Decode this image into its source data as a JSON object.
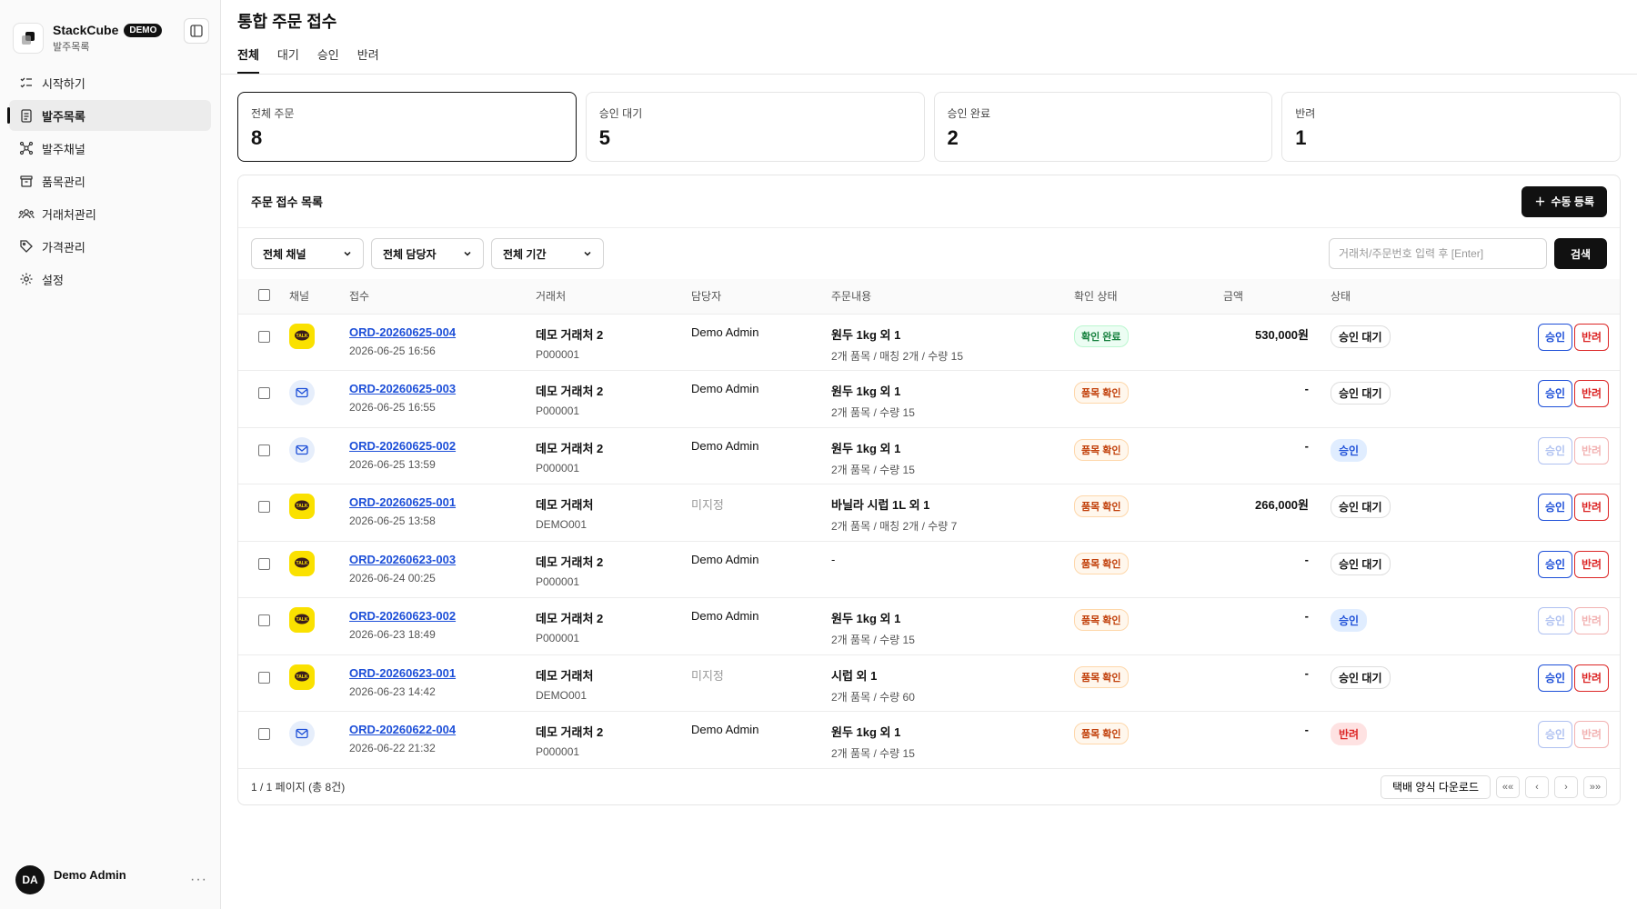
{
  "brand": {
    "name": "StackCube",
    "badge": "DEMO",
    "subtitle": "발주목록"
  },
  "sidebar": {
    "items": [
      {
        "label": "시작하기",
        "icon": "checklist-icon"
      },
      {
        "label": "발주목록",
        "icon": "clipboard-list-icon",
        "active": true
      },
      {
        "label": "발주채널",
        "icon": "network-icon"
      },
      {
        "label": "품목관리",
        "icon": "archive-box-icon"
      },
      {
        "label": "거래처관리",
        "icon": "users-icon"
      },
      {
        "label": "가격관리",
        "icon": "tag-icon"
      },
      {
        "label": "설정",
        "icon": "gear-icon"
      }
    ]
  },
  "user": {
    "initials": "DA",
    "name": "Demo Admin"
  },
  "page": {
    "title": "통합 주문 접수"
  },
  "tabs": [
    {
      "label": "전체"
    },
    {
      "label": "대기"
    },
    {
      "label": "승인"
    },
    {
      "label": "반려"
    }
  ],
  "stats": [
    {
      "label": "전체 주문",
      "value": "8"
    },
    {
      "label": "승인 대기",
      "value": "5"
    },
    {
      "label": "승인 완료",
      "value": "2"
    },
    {
      "label": "반려",
      "value": "1"
    }
  ],
  "panel": {
    "title": "주문 접수 목록",
    "add_label": "수동 등록"
  },
  "filters": {
    "channel": "전체 채널",
    "manager": "전체 담당자",
    "period": "전체 기간",
    "search_placeholder": "거래처/주문번호 입력 후 [Enter]",
    "search_label": "검색"
  },
  "table": {
    "headers": {
      "channel": "채널",
      "received": "접수",
      "client": "거래처",
      "manager": "담당자",
      "content": "주문내용",
      "check": "확인 상태",
      "amount": "금액",
      "status": "상태"
    },
    "rows": [
      {
        "channel": "kakao",
        "order_no": "ORD-20260625-004",
        "date": "2026-06-25 16:56",
        "client": "데모 거래처 2",
        "client_code": "P000001",
        "manager": "Demo Admin",
        "item": "원두 1kg 외 1",
        "detail": "2개 품목 / 매칭 2개 / 수량 15",
        "check": "확인 완료",
        "amount": "530,000원",
        "status": "승인 대기"
      },
      {
        "channel": "mail",
        "order_no": "ORD-20260625-003",
        "date": "2026-06-25 16:55",
        "client": "데모 거래처 2",
        "client_code": "P000001",
        "manager": "Demo Admin",
        "item": "원두 1kg 외 1",
        "detail": "2개 품목 / 수량 15",
        "check": "품목 확인",
        "amount": "-",
        "status": "승인 대기"
      },
      {
        "channel": "mail",
        "order_no": "ORD-20260625-002",
        "date": "2026-06-25 13:59",
        "client": "데모 거래처 2",
        "client_code": "P000001",
        "manager": "Demo Admin",
        "item": "원두 1kg 외 1",
        "detail": "2개 품목 / 수량 15",
        "check": "품목 확인",
        "amount": "-",
        "status": "승인"
      },
      {
        "channel": "kakao",
        "order_no": "ORD-20260625-001",
        "date": "2026-06-25 13:58",
        "client": "데모 거래처",
        "client_code": "DEMO001",
        "manager": "미지정",
        "item": "바닐라 시럽 1L 외 1",
        "detail": "2개 품목 / 매칭 2개 / 수량 7",
        "check": "품목 확인",
        "amount": "266,000원",
        "status": "승인 대기"
      },
      {
        "channel": "kakao",
        "order_no": "ORD-20260623-003",
        "date": "2026-06-24 00:25",
        "client": "데모 거래처 2",
        "client_code": "P000001",
        "manager": "Demo Admin",
        "item": "-",
        "detail": "",
        "check": "품목 확인",
        "amount": "-",
        "status": "승인 대기"
      },
      {
        "channel": "kakao",
        "order_no": "ORD-20260623-002",
        "date": "2026-06-23 18:49",
        "client": "데모 거래처 2",
        "client_code": "P000001",
        "manager": "Demo Admin",
        "item": "원두 1kg 외 1",
        "detail": "2개 품목 / 수량 15",
        "check": "품목 확인",
        "amount": "-",
        "status": "승인"
      },
      {
        "channel": "kakao",
        "order_no": "ORD-20260623-001",
        "date": "2026-06-23 14:42",
        "client": "데모 거래처",
        "client_code": "DEMO001",
        "manager": "미지정",
        "item": "시럽 외 1",
        "detail": "2개 품목 / 수량 60",
        "check": "품목 확인",
        "amount": "-",
        "status": "승인 대기"
      },
      {
        "channel": "mail",
        "order_no": "ORD-20260622-004",
        "date": "2026-06-22 21:32",
        "client": "데모 거래처 2",
        "client_code": "P000001",
        "manager": "Demo Admin",
        "item": "원두 1kg 외 1",
        "detail": "2개 품목 / 수량 15",
        "check": "품목 확인",
        "amount": "-",
        "status": "반려"
      }
    ],
    "approve_label": "승인",
    "reject_label": "반려"
  },
  "footer": {
    "page_info": "1 / 1 페이지 (총 8건)",
    "download_label": "택배 양식 다운로드",
    "first": "««",
    "prev": "‹",
    "next": "›",
    "last": "»»"
  },
  "colors": {
    "accent": "#1d4fd8",
    "danger": "#dc2626",
    "kakao": "#fae100",
    "success": "#15803d",
    "warning": "#c2410c"
  }
}
